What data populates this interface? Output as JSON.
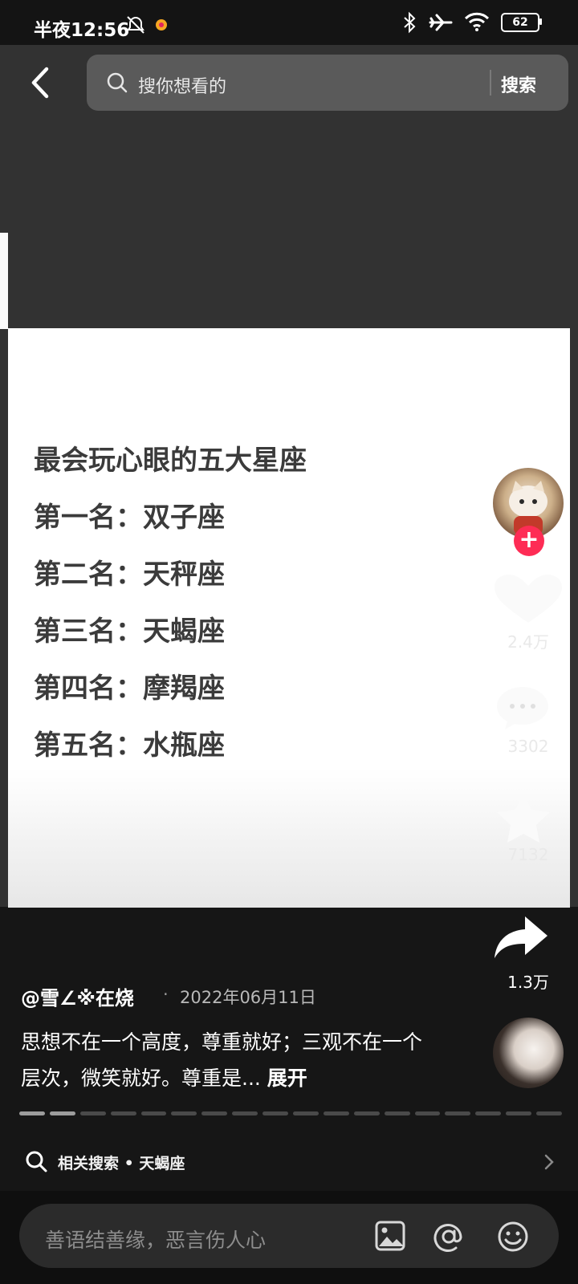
{
  "status_bar": {
    "time": "半夜12:56",
    "battery": "62"
  },
  "header": {
    "search_placeholder": "搜你想看的",
    "search_button": "搜索"
  },
  "video": {
    "title": "最会玩心眼的五大星座",
    "rankings": [
      "第一名：双子座",
      "第二名：天秤座",
      "第三名：天蝎座",
      "第四名：摩羯座",
      "第五名：水瓶座"
    ]
  },
  "actions": {
    "likes": "2.4万",
    "comments": "3302",
    "favorites": "7132",
    "shares": "1.3万"
  },
  "post": {
    "author": "@雪∠※在烧",
    "separator": "·",
    "date": "2022年06月11日",
    "caption": "思想不在一个高度，尊重就好；三观不在一个层次，微笑就好。尊重是...",
    "expand": "展开",
    "progress": {
      "segments_total": 18,
      "segments_viewed": 2
    }
  },
  "related_search": {
    "label": "相关搜索 • 天蝎座"
  },
  "comment_bar": {
    "placeholder": "善语结善缘，恶言伤人心"
  },
  "colors": {
    "follow_accent": "#fe2c55",
    "video_text": "#3b3b3b"
  }
}
